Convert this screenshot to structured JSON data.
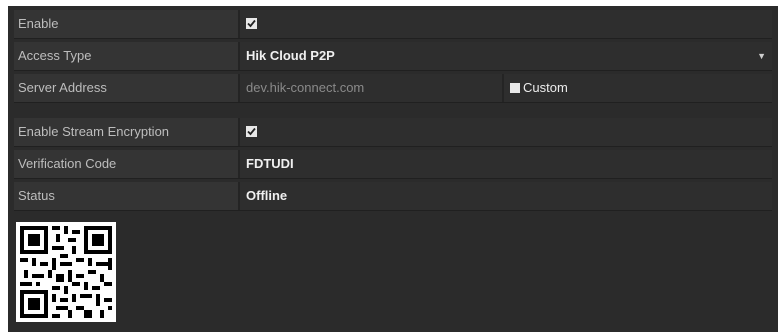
{
  "fields": {
    "enable": {
      "label": "Enable",
      "checked": true
    },
    "access_type": {
      "label": "Access Type",
      "value": "Hik Cloud P2P"
    },
    "server_address": {
      "label": "Server Address",
      "value": "dev.hik-connect.com",
      "custom_label": "Custom",
      "custom_checked": false
    },
    "stream_encryption": {
      "label": "Enable Stream Encryption",
      "checked": true
    },
    "verification_code": {
      "label": "Verification Code",
      "value": "FDTUDI"
    },
    "status": {
      "label": "Status",
      "value": "Offline"
    }
  },
  "icons": {
    "dropdown": "chevron-down-icon",
    "qr": "qr-code-icon"
  },
  "colors": {
    "panel_bg": "#2b2b2b",
    "label_bg": "#343434",
    "value_bg": "#2e2e2e",
    "text": "#e6e6e6",
    "label_text": "#bdbdbd"
  }
}
